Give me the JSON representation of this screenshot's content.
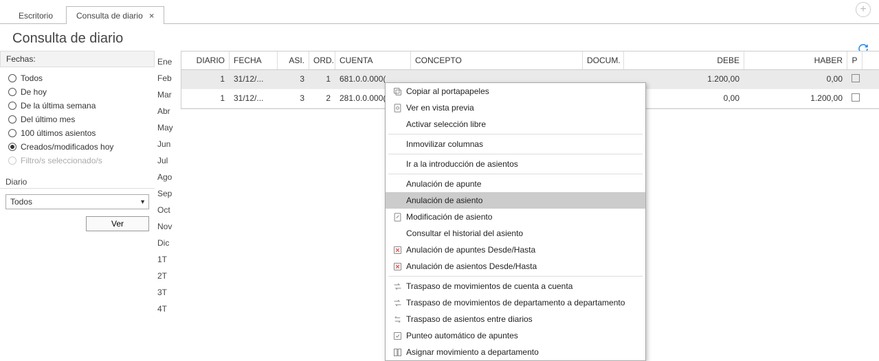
{
  "tabs": [
    {
      "label": "Escritorio",
      "closable": false,
      "active": false
    },
    {
      "label": "Consulta de diario",
      "closable": true,
      "active": true
    }
  ],
  "page_title": "Consulta de diario",
  "fechas": {
    "heading": "Fechas:",
    "options": [
      {
        "label": "Todos",
        "checked": false,
        "disabled": false
      },
      {
        "label": "De hoy",
        "checked": false,
        "disabled": false
      },
      {
        "label": "De la última semana",
        "checked": false,
        "disabled": false
      },
      {
        "label": "Del último mes",
        "checked": false,
        "disabled": false
      },
      {
        "label": "100 últimos asientos",
        "checked": false,
        "disabled": false
      },
      {
        "label": "Creados/modificados hoy",
        "checked": true,
        "disabled": false
      },
      {
        "label": "Filtro/s seleccionado/s",
        "checked": false,
        "disabled": true
      }
    ]
  },
  "diario": {
    "heading": "Diario",
    "selected": "Todos",
    "ver_label": "Ver"
  },
  "months": [
    "Ene",
    "Feb",
    "Mar",
    "Abr",
    "May",
    "Jun",
    "Jul",
    "Ago",
    "Sep",
    "Oct",
    "Nov",
    "Dic",
    "1T",
    "2T",
    "3T",
    "4T"
  ],
  "grid": {
    "columns": [
      "DIARIO",
      "FECHA",
      "ASI.",
      "ORD.",
      "CUENTA",
      "CONCEPTO",
      "DOCUM.",
      "DEBE",
      "HABER",
      "P"
    ],
    "rows": [
      {
        "diario": "1",
        "fecha": "31/12/...",
        "asi": "3",
        "ord": "1",
        "cuenta": "681.0.0.000(",
        "concepto": "",
        "docum": "",
        "debe": "1.200,00",
        "haber": "0,00",
        "selected": true
      },
      {
        "diario": "1",
        "fecha": "31/12/...",
        "asi": "3",
        "ord": "2",
        "cuenta": "281.0.0.000(",
        "concepto": "",
        "docum": "",
        "debe": "0,00",
        "haber": "1.200,00",
        "selected": false
      }
    ]
  },
  "context_menu": {
    "items": [
      {
        "label": "Copiar al portapapeles",
        "icon": "copy-icon"
      },
      {
        "label": "Ver en vista previa",
        "icon": "preview-icon"
      },
      {
        "label": "Activar selección libre",
        "icon": ""
      },
      {
        "sep": true
      },
      {
        "label": "Inmovilizar columnas",
        "icon": ""
      },
      {
        "sep": true
      },
      {
        "label": "Ir a la introducción de asientos",
        "icon": ""
      },
      {
        "sep": true
      },
      {
        "label": "Anulación de apunte",
        "icon": ""
      },
      {
        "label": "Anulación de asiento",
        "icon": "",
        "highlight": true
      },
      {
        "label": "Modificación de asiento",
        "icon": "edit-icon"
      },
      {
        "label": "Consultar el historial del asiento",
        "icon": ""
      },
      {
        "label": "Anulación de apuntes Desde/Hasta",
        "icon": "delete-range-icon"
      },
      {
        "label": "Anulación de asientos Desde/Hasta",
        "icon": "delete-range-icon"
      },
      {
        "sep": true
      },
      {
        "label": "Traspaso de movimientos de cuenta a cuenta",
        "icon": "transfer-icon"
      },
      {
        "label": "Traspaso de movimientos de departamento a departamento",
        "icon": "transfer-icon"
      },
      {
        "label": "Traspaso de asientos entre diarios",
        "icon": "swap-icon"
      },
      {
        "label": "Punteo automático de apuntes",
        "icon": "check-icon"
      },
      {
        "label": "Asignar movimiento a departamento",
        "icon": "assign-icon"
      }
    ]
  }
}
